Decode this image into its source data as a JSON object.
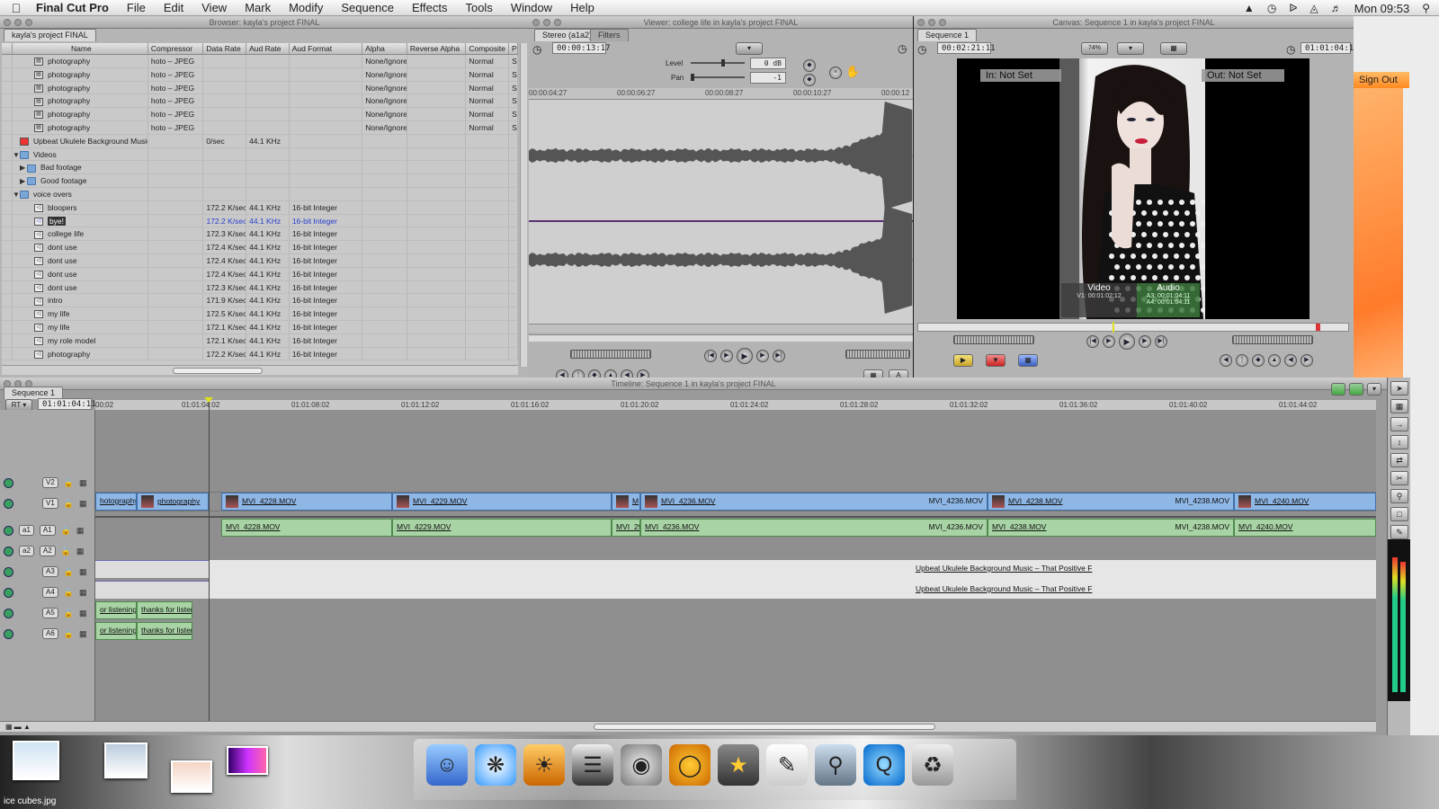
{
  "menubar": {
    "app_name": "Final Cut Pro",
    "items": [
      "File",
      "Edit",
      "View",
      "Mark",
      "Modify",
      "Sequence",
      "Effects",
      "Tools",
      "Window",
      "Help"
    ],
    "clock": "Mon 09:53"
  },
  "browser": {
    "title": "Browser: kayla's project FINAL",
    "tab": "kayla's project FINAL",
    "columns": [
      "Name",
      "Compressor",
      "Data Rate",
      "Aud Rate",
      "Aud Format",
      "Alpha",
      "Reverse Alpha",
      "Composite",
      "Pi"
    ],
    "rows": [
      {
        "name": "photography",
        "compressor": "hoto – JPEG",
        "data_rate": "",
        "aud_rate": "",
        "aud_format": "",
        "alpha": "None/Ignore",
        "rev": "",
        "comp": "Normal",
        "pi": "Sq"
      },
      {
        "name": "photography",
        "compressor": "hoto – JPEG",
        "data_rate": "",
        "aud_rate": "",
        "aud_format": "",
        "alpha": "None/Ignore",
        "rev": "",
        "comp": "Normal",
        "pi": "Sq"
      },
      {
        "name": "photography",
        "compressor": "hoto – JPEG",
        "data_rate": "",
        "aud_rate": "",
        "aud_format": "",
        "alpha": "None/Ignore",
        "rev": "",
        "comp": "Normal",
        "pi": "Sq"
      },
      {
        "name": "photography",
        "compressor": "hoto – JPEG",
        "data_rate": "",
        "aud_rate": "",
        "aud_format": "",
        "alpha": "None/Ignore",
        "rev": "",
        "comp": "Normal",
        "pi": "Sq"
      },
      {
        "name": "photography",
        "compressor": "hoto – JPEG",
        "data_rate": "",
        "aud_rate": "",
        "aud_format": "",
        "alpha": "None/Ignore",
        "rev": "",
        "comp": "Normal",
        "pi": "Sq"
      },
      {
        "name": "photography",
        "compressor": "hoto – JPEG",
        "data_rate": "",
        "aud_rate": "",
        "aud_format": "",
        "alpha": "None/Ignore",
        "rev": "",
        "comp": "Normal",
        "pi": "Sq"
      },
      {
        "name": "Upbeat Ukulele Background Music –",
        "compressor": "",
        "data_rate": "0/sec",
        "aud_rate": "44.1 KHz",
        "aud_format": "",
        "alpha": "",
        "rev": "",
        "comp": "",
        "pi": ""
      },
      {
        "name": "Videos",
        "compressor": "",
        "data_rate": "",
        "aud_rate": "",
        "aud_format": "",
        "alpha": "",
        "rev": "",
        "comp": "",
        "pi": ""
      },
      {
        "name": "Bad footage",
        "compressor": "",
        "data_rate": "",
        "aud_rate": "",
        "aud_format": "",
        "alpha": "",
        "rev": "",
        "comp": "",
        "pi": ""
      },
      {
        "name": "Good footage",
        "compressor": "",
        "data_rate": "",
        "aud_rate": "",
        "aud_format": "",
        "alpha": "",
        "rev": "",
        "comp": "",
        "pi": ""
      },
      {
        "name": "voice overs",
        "compressor": "",
        "data_rate": "",
        "aud_rate": "",
        "aud_format": "",
        "alpha": "",
        "rev": "",
        "comp": "",
        "pi": ""
      },
      {
        "name": "bloopers",
        "compressor": "",
        "data_rate": "172.2 K/sec",
        "aud_rate": "44.1 KHz",
        "aud_format": "16-bit Integer",
        "alpha": "",
        "rev": "",
        "comp": "",
        "pi": ""
      },
      {
        "name": "bye!",
        "compressor": "",
        "data_rate": "172.2 K/sec",
        "aud_rate": "44.1 KHz",
        "aud_format": "16-bit Integer",
        "alpha": "",
        "rev": "",
        "comp": "",
        "pi": ""
      },
      {
        "name": "college life",
        "compressor": "",
        "data_rate": "172.3 K/sec",
        "aud_rate": "44.1 KHz",
        "aud_format": "16-bit Integer",
        "alpha": "",
        "rev": "",
        "comp": "",
        "pi": ""
      },
      {
        "name": "dont use",
        "compressor": "",
        "data_rate": "172.4 K/sec",
        "aud_rate": "44.1 KHz",
        "aud_format": "16-bit Integer",
        "alpha": "",
        "rev": "",
        "comp": "",
        "pi": ""
      },
      {
        "name": "dont use",
        "compressor": "",
        "data_rate": "172.4 K/sec",
        "aud_rate": "44.1 KHz",
        "aud_format": "16-bit Integer",
        "alpha": "",
        "rev": "",
        "comp": "",
        "pi": ""
      },
      {
        "name": "dont use",
        "compressor": "",
        "data_rate": "172.4 K/sec",
        "aud_rate": "44.1 KHz",
        "aud_format": "16-bit Integer",
        "alpha": "",
        "rev": "",
        "comp": "",
        "pi": ""
      },
      {
        "name": "dont use",
        "compressor": "",
        "data_rate": "172.3 K/sec",
        "aud_rate": "44.1 KHz",
        "aud_format": "16-bit Integer",
        "alpha": "",
        "rev": "",
        "comp": "",
        "pi": ""
      },
      {
        "name": "intro",
        "compressor": "",
        "data_rate": "171.9 K/sec",
        "aud_rate": "44.1 KHz",
        "aud_format": "16-bit Integer",
        "alpha": "",
        "rev": "",
        "comp": "",
        "pi": ""
      },
      {
        "name": "my life",
        "compressor": "",
        "data_rate": "172.5 K/sec",
        "aud_rate": "44.1 KHz",
        "aud_format": "16-bit Integer",
        "alpha": "",
        "rev": "",
        "comp": "",
        "pi": ""
      },
      {
        "name": "my life",
        "compressor": "",
        "data_rate": "172.1 K/sec",
        "aud_rate": "44.1 KHz",
        "aud_format": "16-bit Integer",
        "alpha": "",
        "rev": "",
        "comp": "",
        "pi": ""
      },
      {
        "name": "my role model",
        "compressor": "",
        "data_rate": "172.1 K/sec",
        "aud_rate": "44.1 KHz",
        "aud_format": "16-bit Integer",
        "alpha": "",
        "rev": "",
        "comp": "",
        "pi": ""
      },
      {
        "name": "photography",
        "compressor": "",
        "data_rate": "172.2 K/sec",
        "aud_rate": "44.1 KHz",
        "aud_format": "16-bit Integer",
        "alpha": "",
        "rev": "",
        "comp": "",
        "pi": ""
      }
    ]
  },
  "viewer": {
    "title": "Viewer: college life in kayla's project FINAL",
    "tabs": [
      "Stereo (a1a2)",
      "Filters"
    ],
    "timecode": "00:00:13:17",
    "level_label": "Level",
    "level_value": "0 dB",
    "pan_label": "Pan",
    "pan_value": "-1",
    "ruler": [
      "00:00:04:27",
      "00:00:06:27",
      "00:00:08:27",
      "00:00:10:27",
      "00:00:12"
    ]
  },
  "canvas": {
    "title": "Canvas: Sequence 1 in kayla's project FINAL",
    "tab": "Sequence 1",
    "duration": "00:02:21:11",
    "zoom": "74%",
    "timecode": "01:01:04:11",
    "in_label": "In: Not Set",
    "out_label": "Out: Not Set",
    "video_label": "Video",
    "audio_label": "Audio",
    "v1_tc": "V1: 00:01:02:12",
    "a3_tc": "A3: 00:01:04:11",
    "a4_tc": "A4: 00:01:04:11"
  },
  "right_window": {
    "signout": "Sign Out"
  },
  "timeline": {
    "title": "Timeline: Sequence 1 in kayla's project FINAL",
    "tab": "Sequence 1",
    "rt_label": "RT",
    "timecode": "01:01:04:11",
    "ruler": [
      "00;02",
      "01:01:04:02",
      "01:01:08:02",
      "01:01:12:02",
      "01:01:16:02",
      "01:01:20:02",
      "01:01:24:02",
      "01:01:28:02",
      "01:01:32:02",
      "01:01:36:02",
      "01:01:40:02",
      "01:01:44:02"
    ],
    "track_labels": [
      "V2",
      "V1",
      "A1",
      "A2",
      "A3",
      "A4",
      "A5",
      "A6"
    ],
    "source_labels": [
      "a1",
      "a2"
    ],
    "v1_clips": [
      "hotography",
      "photography",
      "MVI_4228.MOV",
      "MVI_4229.MOV",
      "M",
      "MVI_4236.MOV",
      "MVI_4236.MOV",
      "MVI_4238.MOV",
      "MVI_4238.MOV",
      "MVI_4240.MOV"
    ],
    "a1_clips": [
      "MVI_4228.MOV",
      "MVI_4229.MOV",
      "MVI_29",
      "MVI_4236.MOV",
      "MVI_4236.MOV",
      "MVI_4238.MOV",
      "MVI_4238.MOV",
      "MVI_4240.MOV"
    ],
    "music_clip": "Upbeat Ukulele Background Music – That Positive F",
    "voice_clips": [
      "or listening",
      "thanks for listen"
    ]
  },
  "desktop": {
    "file_label": "ice cubes.jpg"
  }
}
